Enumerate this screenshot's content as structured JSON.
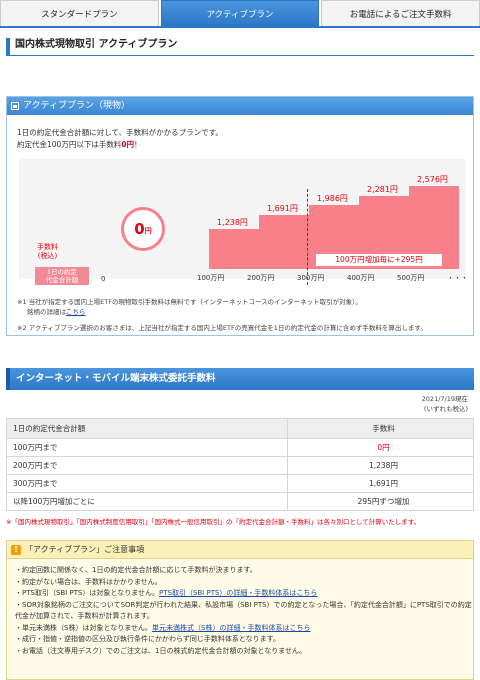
{
  "tabs": [
    {
      "label": "スタンダードプラン",
      "active": false
    },
    {
      "label": "アクティブプラン",
      "active": true
    },
    {
      "label": "お電話によるご注文手数料",
      "active": false
    }
  ],
  "page_title": "国内株式現物取引 アクティブプラン",
  "plan_box": {
    "title": "アクティブプラン（現物）",
    "intro_line1": "1日の約定代金合計額に対して、手数料がかかるプランです。",
    "intro_line2_pre": "約定代金100万円以下は手数料",
    "intro_line2_red": "0円",
    "intro_line2_post": "！",
    "zero_fee": "0",
    "zero_unit": "円",
    "fee_label_line1": "手数料",
    "fee_label_line2": "(税込)",
    "amount_label_line1": "1日の約定",
    "amount_label_line2": "代金合計額",
    "axis_start": "0",
    "increment_note": "100万円増加毎に+295円",
    "notes": [
      "※1 当社が指定する国内上場ETFの現物取引手数料は無料です（インターネットコースのインターネット取引が対象）。",
      "銘柄の詳細は",
      "こちら",
      "※2 アクティブプラン選択のお客さまは、上記当社が指定する国内上場ETFの売買代金を1日の約定代金の計算に含めず手数料を算出します。"
    ]
  },
  "chart_data": {
    "type": "bar",
    "categories": [
      "100万円",
      "200万円",
      "300万円",
      "400万円",
      "500万円",
      "・・・"
    ],
    "values": [
      1238,
      1691,
      1986,
      2281,
      2576
    ],
    "value_labels": [
      "1,238",
      "1,691",
      "1,986",
      "2,281",
      "2,576"
    ],
    "value_unit": "円",
    "ylabel": "手数料(税込)",
    "xlabel": "1日の約定代金合計額"
  },
  "commission": {
    "title": "インターネット・モバイル端末株式委託手数料",
    "date": "2021/7/19現在",
    "tax_note": "(いずれも税込)",
    "headers": [
      "1日の約定代金合計額",
      "手数料"
    ],
    "rows": [
      [
        "100万円まで",
        "0円"
      ],
      [
        "200万円まで",
        "1,238円"
      ],
      [
        "300万円まで",
        "1,691円"
      ],
      [
        "以降100万円増加ごとに",
        "295円ずつ増加"
      ]
    ],
    "red_note": "※「国内株式現物取引」「国内株式制度信用取引」「国内株式一般信用取引」の「約定代金合計額・手数料」は各々別口として計算いたします。"
  },
  "caution": {
    "title": "「アクティブプラン」ご注意事項",
    "items": [
      {
        "text": "約定回数に関係なく、1日の約定代金合計額に応じて手数料が決まります。"
      },
      {
        "text": "約定がない場合は、手数料はかかりません。"
      },
      {
        "text": "PTS取引（SBI PTS）は対象となりません。",
        "link": "PTS取引（SBI PTS）の詳細・手数料体系はこちら"
      },
      {
        "text": "SOR対象銘柄のご注文についてSOR判定が行われた結果、私設市場（SBI PTS）での約定となった場合、「約定代金合計額」にPTS取引での約定代金が加算されて、手数料が計算されます。"
      },
      {
        "text": "単元未満株（S株）は対象となりません。",
        "link": "単元未満株式（S株）の詳細・手数料体系はこちら"
      },
      {
        "text": "成行・指値・逆指値の区分及び執行条件にかかわらず同じ手数料体系となります。"
      },
      {
        "text": "お電話（注文専用デスク）でのご注文は、1日の株式約定代金合計額の対象となりません。"
      }
    ]
  },
  "colors": {
    "accent": "#2c78c8",
    "red": "#e60012",
    "bar": "#f7808a"
  }
}
